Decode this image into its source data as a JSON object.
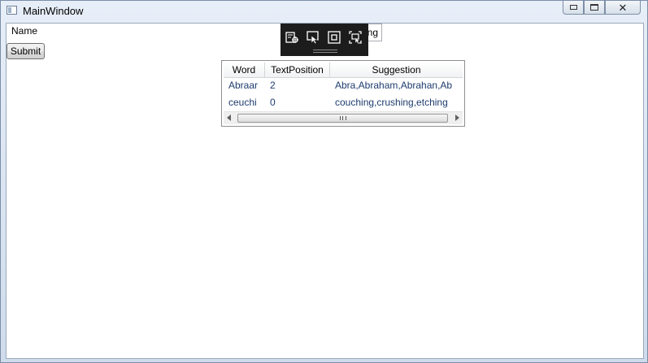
{
  "window": {
    "title": "MainWindow",
    "controls": {
      "minimize_icon": "minimize-icon",
      "maximize_icon": "maximize-icon",
      "close_icon": "close-icon",
      "close_glyph": "✕"
    }
  },
  "form": {
    "name_label": "Name",
    "text_input_value": "ng",
    "submit_label": "Submit"
  },
  "floating_toolbar": {
    "icons": [
      "select-element-icon",
      "pointer-select-icon",
      "track-focus-icon",
      "display-layout-icon"
    ]
  },
  "grid": {
    "columns": [
      "Word",
      "TextPosition",
      "Suggestion"
    ],
    "rows": [
      {
        "word": "Abraar",
        "position": "2",
        "suggestion": "Abra,Abraham,Abrahan,Ab"
      },
      {
        "word": "ceuchi",
        "position": "0",
        "suggestion": "couching,crushing,etching"
      }
    ]
  },
  "colors": {
    "cell_text": "#1e3c6e",
    "toolbar_bg": "#1c1c1c"
  }
}
